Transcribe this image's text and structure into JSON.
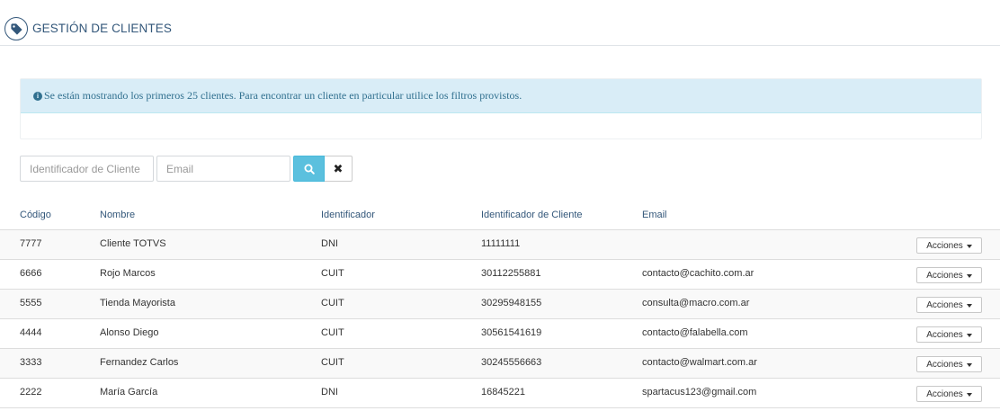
{
  "header": {
    "title": "GESTIÓN DE CLIENTES",
    "icon": "tag-icon"
  },
  "alert": {
    "icon": "info-circle-icon",
    "message": "Se están mostrando los primeros 25 clientes. Para encontrar un cliente en particular utilice los filtros provistos."
  },
  "filters": {
    "id_placeholder": "Identificador de Cliente",
    "id_value": "",
    "email_placeholder": "Email",
    "email_value": "",
    "search_icon": "search-icon",
    "clear_icon": "close-icon",
    "clear_glyph": "✖",
    "search_color": "#5bc0de"
  },
  "table": {
    "columns": [
      "Código",
      "Nombre",
      "Identificador",
      "Identificador de Cliente",
      "Email"
    ],
    "action_label": "Acciones",
    "rows": [
      {
        "code": "7777",
        "name": "Cliente TOTVS",
        "id_type": "DNI",
        "id_value": "11111111",
        "email": ""
      },
      {
        "code": "6666",
        "name": "Rojo Marcos",
        "id_type": "CUIT",
        "id_value": "30112255881",
        "email": "contacto@cachito.com.ar"
      },
      {
        "code": "5555",
        "name": "Tienda Mayorista",
        "id_type": "CUIT",
        "id_value": "30295948155",
        "email": "consulta@macro.com.ar"
      },
      {
        "code": "4444",
        "name": "Alonso Diego",
        "id_type": "CUIT",
        "id_value": "30561541619",
        "email": "contacto@falabella.com"
      },
      {
        "code": "3333",
        "name": "Fernandez Carlos",
        "id_type": "CUIT",
        "id_value": "30245556663",
        "email": "contacto@walmart.com.ar"
      },
      {
        "code": "2222",
        "name": "María García",
        "id_type": "DNI",
        "id_value": "16845221",
        "email": "spartacus123@gmail.com"
      }
    ]
  },
  "colors": {
    "heading": "#33577a",
    "alert_bg": "#d9edf7",
    "alert_text": "#31708f",
    "stripe": "#f9f9f9"
  }
}
